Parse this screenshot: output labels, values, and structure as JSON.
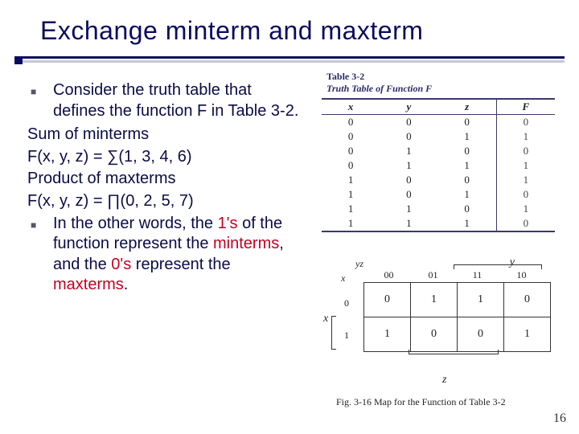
{
  "title": "Exchange minterm and maxterm",
  "page_number": "16",
  "bullets": {
    "b1": "Consider the truth table that defines the function F in Table 3-2.",
    "l1": "Sum of minterms",
    "l2": "F(x, y, z) = ∑(1, 3, 4, 6)",
    "l3": "Product of maxterms",
    "l4": "F(x, y, z) = ∏(0, 2, 5, 7)",
    "b2_pre": "In the other words, the ",
    "b2_ones": "1's",
    "b2_mid1": " of the function represent the ",
    "b2_min": "minterms",
    "b2_mid2": ", and the ",
    "b2_zeros": "0's",
    "b2_mid3": " represent the ",
    "b2_max": "maxterms",
    "b2_end": "."
  },
  "truth_table": {
    "label_a": "Table 3-2",
    "label_b": "Truth Table of Function F",
    "headers": [
      "x",
      "y",
      "z",
      "F"
    ],
    "rows": [
      [
        "0",
        "0",
        "0",
        "0"
      ],
      [
        "0",
        "0",
        "1",
        "1"
      ],
      [
        "0",
        "1",
        "0",
        "0"
      ],
      [
        "0",
        "1",
        "1",
        "1"
      ],
      [
        "1",
        "0",
        "0",
        "1"
      ],
      [
        "1",
        "0",
        "1",
        "0"
      ],
      [
        "1",
        "1",
        "0",
        "1"
      ],
      [
        "1",
        "1",
        "1",
        "0"
      ]
    ]
  },
  "kmap": {
    "y": "y",
    "x": "x",
    "z": "z",
    "yz": "yz",
    "col_labels": [
      "00",
      "01",
      "11",
      "10"
    ],
    "row_labels": [
      "0",
      "1"
    ],
    "cells": [
      [
        "0",
        "1",
        "1",
        "0"
      ],
      [
        "1",
        "0",
        "0",
        "1"
      ]
    ],
    "caption": "Fig. 3-16   Map for the Function of Table 3-2"
  },
  "chart_data": {
    "type": "table",
    "title": "Truth Table of Function F",
    "columns": [
      "x",
      "y",
      "z",
      "F"
    ],
    "rows": [
      [
        0,
        0,
        0,
        0
      ],
      [
        0,
        0,
        1,
        1
      ],
      [
        0,
        1,
        0,
        0
      ],
      [
        0,
        1,
        1,
        1
      ],
      [
        1,
        0,
        0,
        1
      ],
      [
        1,
        0,
        1,
        0
      ],
      [
        1,
        1,
        0,
        1
      ],
      [
        1,
        1,
        1,
        0
      ]
    ],
    "kmap": {
      "row_var": "x",
      "col_vars": "yz",
      "col_order_gray": [
        "00",
        "01",
        "11",
        "10"
      ],
      "grid": [
        [
          0,
          1,
          1,
          0
        ],
        [
          1,
          0,
          0,
          1
        ]
      ]
    }
  }
}
